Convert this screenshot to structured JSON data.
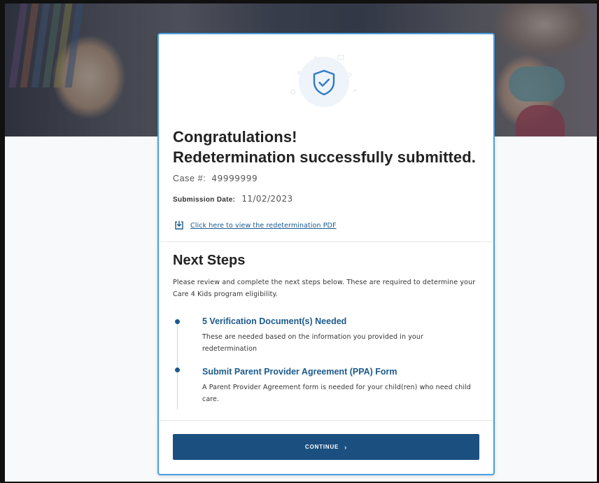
{
  "confirmation": {
    "heading_line1": "Congratulations!",
    "heading_line2": "Redetermination successfully submitted.",
    "case_label": "Case #:",
    "case_number": "49999999",
    "submission_label": "Submission Date:",
    "submission_date": "11/02/2023",
    "pdf_link_label": "Click here to view the redetermination PDF",
    "badge_icon": "shield-check-icon"
  },
  "next_steps": {
    "title": "Next Steps",
    "description": "Please review and complete the next steps below. These are required to determine your Care 4 Kids program eligibility.",
    "items": [
      {
        "title": "5 Verification Document(s) Needed",
        "text": "These are needed based on the information you provided in your redetermination"
      },
      {
        "title": "Submit Parent Provider Agreement (PPA) Form",
        "text": "A Parent Provider Agreement form is needed for your child(ren) who need child care."
      }
    ]
  },
  "actions": {
    "continue_label": "CONTINUE",
    "continue_chevron": "›"
  },
  "colors": {
    "primary": "#1b4f80",
    "link": "#1c5a8e",
    "card_border": "#4a9fe0"
  }
}
